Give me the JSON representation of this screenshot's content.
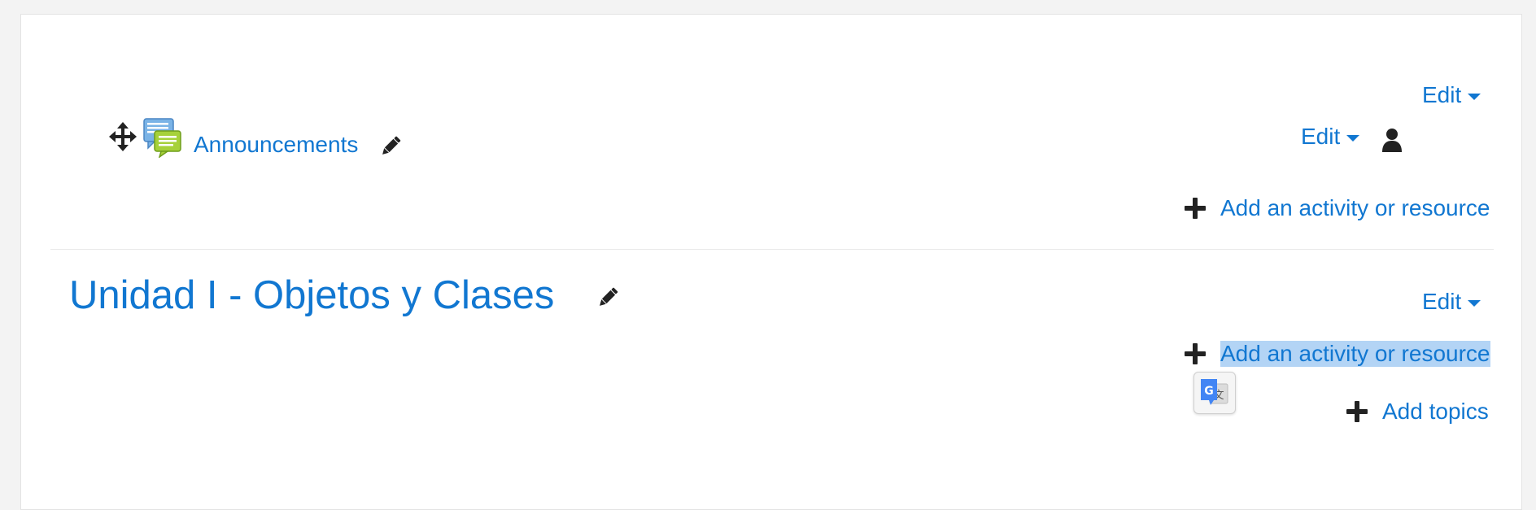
{
  "section0": {
    "edit_label": "Edit",
    "activity": {
      "name": "Announcements",
      "edit_label": "Edit"
    },
    "add_activity_label": "Add an activity or resource"
  },
  "section1": {
    "title": "Unidad I - Objetos y Clases",
    "edit_label": "Edit",
    "add_activity_label": "Add an activity or resource"
  },
  "add_topics_label": "Add topics",
  "colors": {
    "link": "#1177d1",
    "selection": "#b3d4f5",
    "icon": "#222222"
  },
  "icons": [
    "move-icon",
    "forum-icon",
    "pencil-icon",
    "user-icon",
    "plus-icon",
    "google-translate-icon"
  ]
}
